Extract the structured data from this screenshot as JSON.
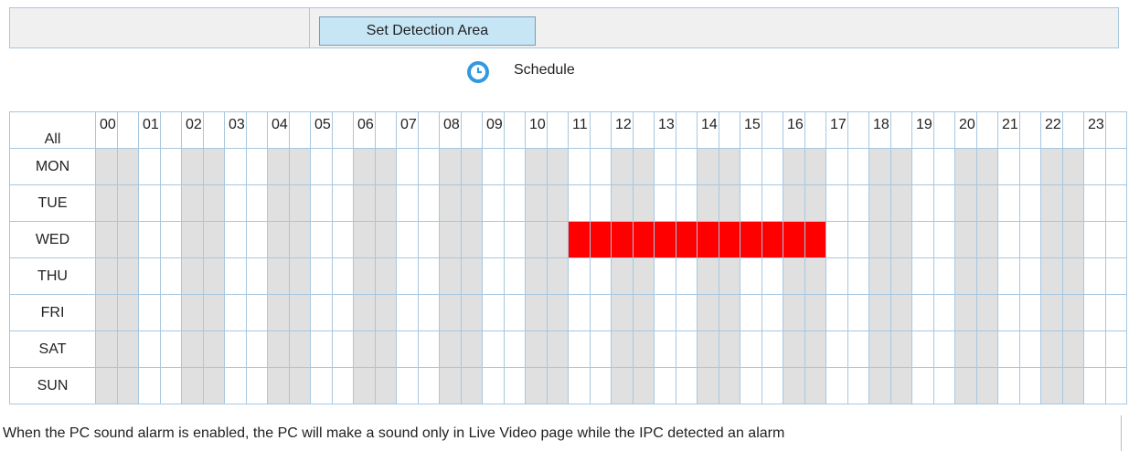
{
  "toolbar": {
    "set_area_label": "Set Detection Area"
  },
  "schedule": {
    "title": "Schedule",
    "all_label": "All",
    "hours": [
      "00",
      "01",
      "02",
      "03",
      "04",
      "05",
      "06",
      "07",
      "08",
      "09",
      "10",
      "11",
      "12",
      "13",
      "14",
      "15",
      "16",
      "17",
      "18",
      "19",
      "20",
      "21",
      "22",
      "23"
    ],
    "days": [
      "MON",
      "TUE",
      "WED",
      "THU",
      "FRI",
      "SAT",
      "SUN"
    ],
    "selected": [
      {
        "day": "WED",
        "from_hour": "11:00",
        "to_hour": "17:00"
      }
    ]
  },
  "colors": {
    "selected": "#ff0000",
    "shade": "#e0e0e0",
    "border": "#a7c7e0",
    "button": "#c6e6f6",
    "icon": "#3399dd"
  },
  "footer": {
    "note": "When the PC sound alarm is enabled, the PC will make a sound only in Live Video page while the IPC detected an alarm"
  }
}
